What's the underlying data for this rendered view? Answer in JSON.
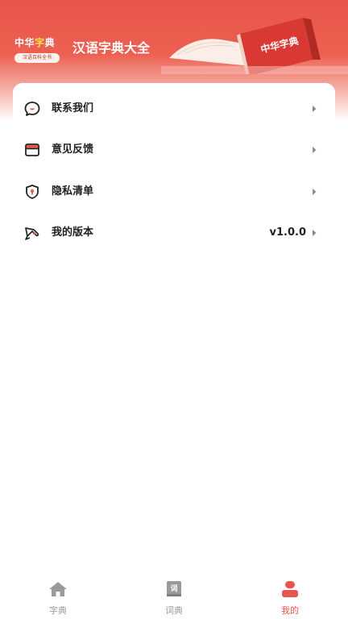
{
  "header": {
    "logo_title_a": "中华",
    "logo_title_b": "字",
    "logo_title_c": "典",
    "logo_subtitle": "汉语百科全书",
    "app_title": "汉语字典大全",
    "book_cover_text": "中华字典"
  },
  "menu": {
    "items": [
      {
        "label": "联系我们",
        "icon": "chat-smile-icon",
        "value": ""
      },
      {
        "label": "意见反馈",
        "icon": "feedback-icon",
        "value": ""
      },
      {
        "label": "隐私清单",
        "icon": "shield-icon",
        "value": ""
      },
      {
        "label": "我的版本",
        "icon": "rocket-icon",
        "value": "v1.0.0"
      }
    ]
  },
  "tabbar": {
    "tabs": [
      {
        "label": "字典",
        "icon": "home-icon",
        "active": false
      },
      {
        "label": "词典",
        "icon": "book-icon",
        "active": false
      },
      {
        "label": "我的",
        "icon": "profile-icon",
        "active": true
      }
    ]
  },
  "colors": {
    "accent": "#e9554a",
    "tab_inactive": "#9a9a9a",
    "text": "#222222"
  }
}
